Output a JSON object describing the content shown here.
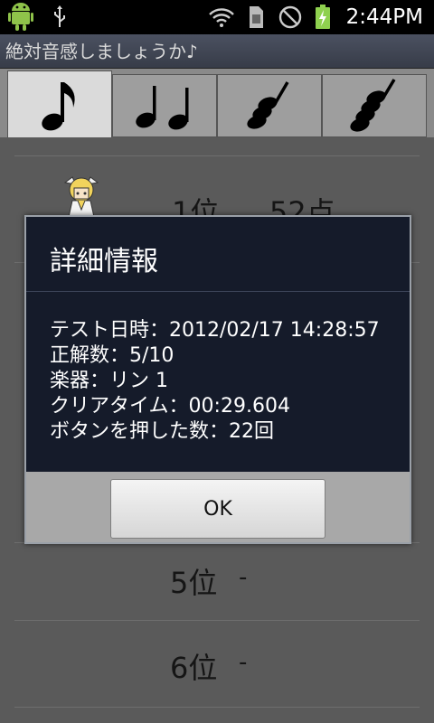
{
  "status_bar": {
    "time": "2:44PM",
    "icons": [
      "android-icon",
      "usb-icon",
      "wifi-icon",
      "sim-icon",
      "no-signal-icon",
      "battery-charging-icon"
    ]
  },
  "app": {
    "title": "絶対音感しましょうか♪"
  },
  "tabs": [
    {
      "icon": "single-eighth-note-icon",
      "selected": true
    },
    {
      "icon": "two-quarter-notes-icon",
      "selected": false
    },
    {
      "icon": "three-note-chord-icon",
      "selected": false
    },
    {
      "icon": "four-note-chord-icon",
      "selected": false
    }
  ],
  "ranking": {
    "rows": [
      {
        "rank": "1位",
        "score": "52点"
      },
      {
        "rank": "5位",
        "score": "-"
      },
      {
        "rank": "6位",
        "score": "-"
      }
    ]
  },
  "dialog": {
    "title": "詳細情報",
    "lines": [
      "テスト日時：2012/02/17 14:28:57",
      "正解数：5/10",
      "楽器：リン 1",
      "クリアタイム：00:29.604",
      "ボタンを押した数：22回"
    ],
    "ok_label": "OK"
  }
}
